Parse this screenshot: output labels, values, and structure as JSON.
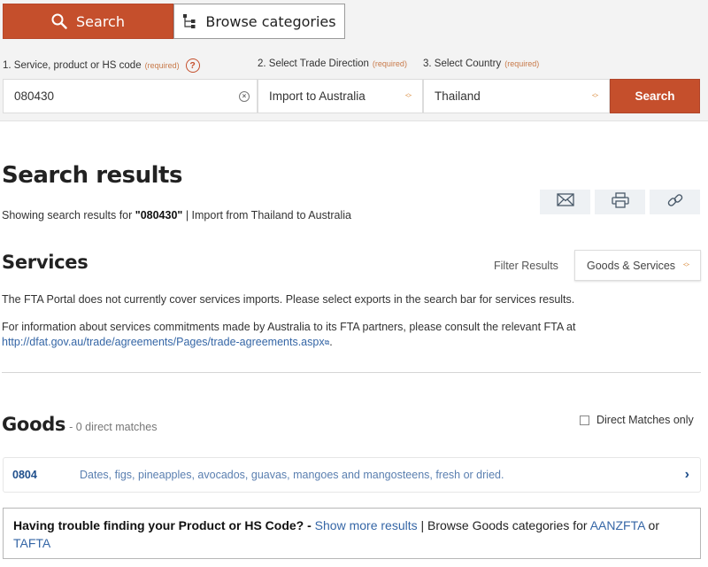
{
  "search_panel": {
    "tabs": [
      {
        "label": "Search",
        "icon": "search-icon",
        "active": true
      },
      {
        "label": "Browse categories",
        "icon": "hierarchy-icon",
        "active": false
      }
    ],
    "fields": {
      "product": {
        "label": "1. Service, product or HS code",
        "required": "(required)",
        "value": "080430",
        "help": "?"
      },
      "direction": {
        "label": "2. Select Trade Direction",
        "required": "(required)",
        "value": "Import to Australia"
      },
      "country": {
        "label": "3. Select Country",
        "required": "(required)",
        "value": "Thailand"
      }
    },
    "search_button": "Search"
  },
  "results": {
    "title": "Search results",
    "sub_prefix": "Showing search results for ",
    "query": "\"080430\"",
    "sub_suffix": " | Import from Thailand to Australia",
    "share_actions": [
      "email-icon",
      "print-icon",
      "link-icon"
    ]
  },
  "services": {
    "title": "Services",
    "filter_label": "Filter Results",
    "filter_value": "Goods & Services",
    "note": "The FTA Portal does not currently cover services imports. Please select exports in the search bar for services results.",
    "info_line1": "For information about services commitments made by Australia to its FTA partners, please consult the relevant FTA at",
    "info_link": "http://dfat.gov.au/trade/agreements/Pages/trade-agreements.aspx",
    "info_end": "."
  },
  "goods": {
    "title": "Goods",
    "count": "- 0 direct matches",
    "direct_only_label": "Direct Matches only",
    "direct_only_checked": false,
    "rows": [
      {
        "code": "0804",
        "description": "Dates, figs, pineapples, avocados, guavas, mangoes and mangosteens, fresh or dried."
      }
    ]
  },
  "help_box": {
    "question": "Having trouble finding your Product or HS Code? -",
    "show_more": "Show more results",
    "separator": " | Browse Goods categories for ",
    "link1": "AANZFTA",
    "or": " or",
    "link2": "TAFTA"
  },
  "colors": {
    "accent": "#c54f2c",
    "link": "#3566a6",
    "code": "#1f4f8c"
  }
}
